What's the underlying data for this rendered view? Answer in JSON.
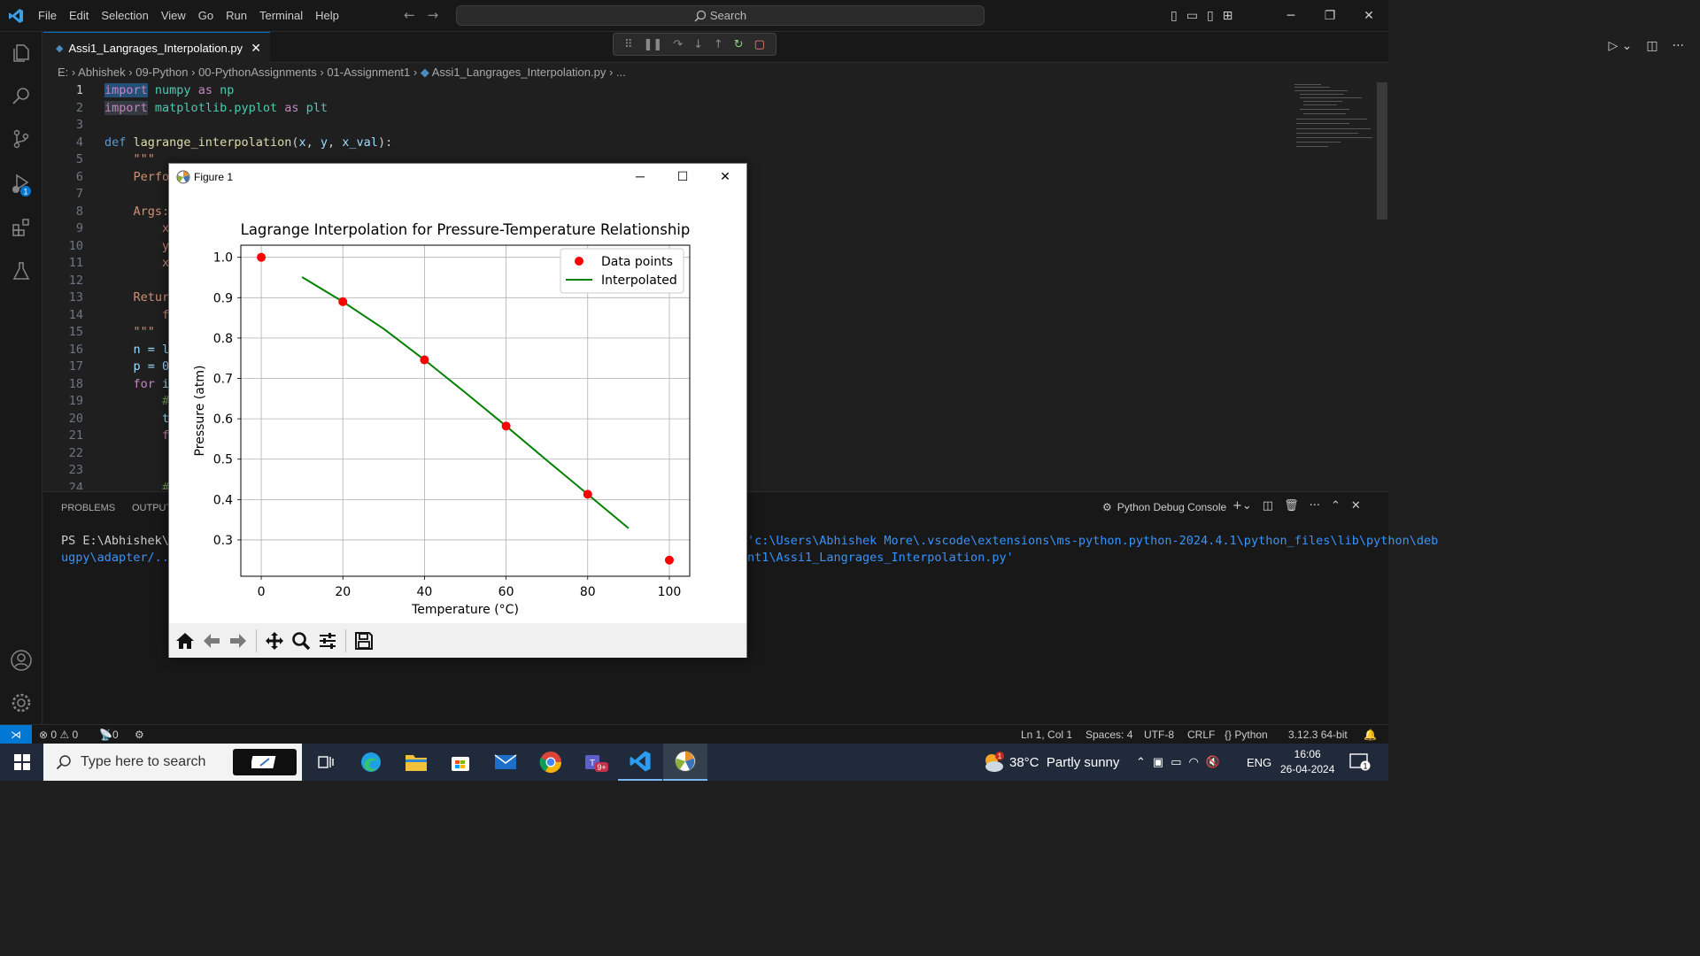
{
  "app": {
    "menu": [
      "File",
      "Edit",
      "Selection",
      "View",
      "Go",
      "Run",
      "Terminal",
      "Help"
    ],
    "search_placeholder": "Search",
    "tab_label": "Assi1_Langrages_Interpolation.py",
    "breadcrumb": [
      "E:",
      "Abhishek",
      "09-Python",
      "00-PythonAssignments",
      "01-Assignment1",
      "Assi1_Langrages_Interpolation.py",
      "..."
    ],
    "debug_badge": "1"
  },
  "code": {
    "line_numbers": [
      "1",
      "2",
      "3",
      "4",
      "5",
      "6",
      "7",
      "8",
      "9",
      "10",
      "11",
      "12",
      "13",
      "14",
      "15",
      "16",
      "17",
      "18",
      "19",
      "20",
      "21",
      "22",
      "23",
      "24"
    ],
    "line1_kw": "import",
    "line1_mod": "numpy",
    "line1_as": "as",
    "line1_alias": "np",
    "line2_kw": "import",
    "line2_mod": "matplotlib.pyplot",
    "line2_as": "as",
    "line2_alias": "plt",
    "line4_def": "def",
    "line4_fn": "lagrange_interpolation",
    "line4_open": "(",
    "line4_p1": "x",
    "line4_c1": ", ",
    "line4_p2": "y",
    "line4_c2": ", ",
    "line4_p3": "x_val",
    "line4_close": "):",
    "line5": "\"\"\"",
    "line6": "Perfo",
    "line8": "Args:",
    "line9": "x",
    "line10": "y",
    "line11": "x",
    "line13": "Retur",
    "line14": "f",
    "line15": "\"\"\"",
    "line16": "n = l",
    "line17": "p = 0",
    "line18_kw": "for",
    "line18_rest": " i",
    "line19": "#",
    "line20": "t",
    "line21": "f",
    "line24": "#"
  },
  "panel": {
    "tabs": [
      "PROBLEMS",
      "OUTPUT"
    ],
    "console_label": "Python Debug Console",
    "term_prompt_1": "PS E:\\Abhishek\\0",
    "term_prompt_2": "ugpy\\adapter/../",
    "term_tail_1": "'c:\\Users\\Abhishek More\\.vscode\\extensions\\ms-python.python-2024.4.1\\python_files\\lib\\python\\deb",
    "term_tail_2": "nt1\\Assi1_Langrages_Interpolation.py'"
  },
  "statusbar": {
    "errors": "0",
    "warnings": "0",
    "ports": "0",
    "position": "Ln 1, Col 1",
    "spaces": "Spaces: 4",
    "encoding": "UTF-8",
    "eol": "CRLF",
    "language": "Python",
    "interpreter": "3.12.3 64-bit"
  },
  "taskbar": {
    "search_placeholder": "Type here to search",
    "teams_badge": "9+",
    "weather_badge": "1",
    "weather": "38°C  Partly sunny",
    "language": "ENG",
    "time": "16:06",
    "date": "26-04-2024",
    "notif_count": "1"
  },
  "figure": {
    "window_title": "Figure 1"
  },
  "chart_data": {
    "type": "line",
    "title": "Lagrange Interpolation for Pressure-Temperature Relationship",
    "xlabel": "Temperature (°C)",
    "ylabel": "Pressure (atm)",
    "xlim": [
      -5,
      105
    ],
    "ylim": [
      0.21,
      1.03
    ],
    "xticks": [
      0,
      20,
      40,
      60,
      80,
      100
    ],
    "yticks": [
      0.3,
      0.4,
      0.5,
      0.6,
      0.7,
      0.8,
      0.9,
      1.0
    ],
    "ytick_labels": [
      "0.3",
      "0.4",
      "0.5",
      "0.6",
      "0.7",
      "0.8",
      "0.9",
      "1.0"
    ],
    "grid": true,
    "legend_position": "top-right",
    "series": [
      {
        "name": "Data points",
        "kind": "scatter",
        "color": "#ff0000",
        "x": [
          0,
          20,
          40,
          60,
          80,
          100
        ],
        "y": [
          1.0,
          0.89,
          0.746,
          0.582,
          0.413,
          0.25
        ]
      },
      {
        "name": "Interpolated",
        "kind": "line",
        "color": "#008000",
        "x": [
          10,
          20,
          30,
          40,
          50,
          60,
          70,
          80,
          90
        ],
        "y": [
          0.951,
          0.89,
          0.823,
          0.746,
          0.665,
          0.582,
          0.497,
          0.413,
          0.329
        ]
      }
    ]
  }
}
